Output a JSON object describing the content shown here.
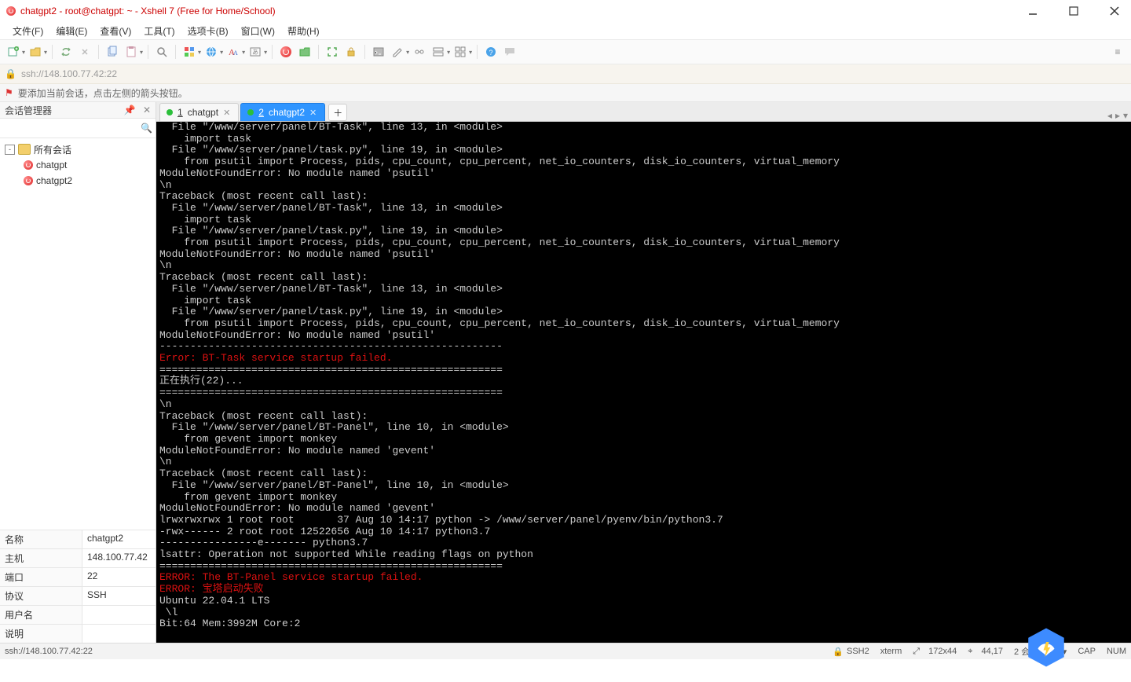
{
  "title": "chatgpt2 - root@chatgpt: ~ - Xshell 7 (Free for Home/School)",
  "menubar": [
    "文件(F)",
    "编辑(E)",
    "查看(V)",
    "工具(T)",
    "选项卡(B)",
    "窗口(W)",
    "帮助(H)"
  ],
  "addressbar": {
    "text": "ssh://148.100.77.42:22"
  },
  "hint": "要添加当前会话，点击左侧的箭头按钮。",
  "sidebar": {
    "title": "会话管理器",
    "search_placeholder": "",
    "root": "所有会话",
    "sessions": [
      "chatgpt",
      "chatgpt2"
    ],
    "props": {
      "名称": "chatgpt2",
      "主机": "148.100.77.42",
      "端口": "22",
      "协议": "SSH",
      "用户名": "",
      "说明": ""
    }
  },
  "tabs": [
    {
      "index": "1",
      "label": "chatgpt",
      "active": false
    },
    {
      "index": "2",
      "label": "chatgpt2",
      "active": true
    }
  ],
  "terminal": {
    "lines": [
      {
        "t": "  File \"/www/server/panel/BT-Task\", line 13, in <module>"
      },
      {
        "t": "    import task"
      },
      {
        "t": "  File \"/www/server/panel/task.py\", line 19, in <module>"
      },
      {
        "t": "    from psutil import Process, pids, cpu_count, cpu_percent, net_io_counters, disk_io_counters, virtual_memory"
      },
      {
        "t": "ModuleNotFoundError: No module named 'psutil'"
      },
      {
        "t": "\\n"
      },
      {
        "t": "Traceback (most recent call last):"
      },
      {
        "t": "  File \"/www/server/panel/BT-Task\", line 13, in <module>"
      },
      {
        "t": "    import task"
      },
      {
        "t": "  File \"/www/server/panel/task.py\", line 19, in <module>"
      },
      {
        "t": "    from psutil import Process, pids, cpu_count, cpu_percent, net_io_counters, disk_io_counters, virtual_memory"
      },
      {
        "t": "ModuleNotFoundError: No module named 'psutil'"
      },
      {
        "t": "\\n"
      },
      {
        "t": "Traceback (most recent call last):"
      },
      {
        "t": "  File \"/www/server/panel/BT-Task\", line 13, in <module>"
      },
      {
        "t": "    import task"
      },
      {
        "t": "  File \"/www/server/panel/task.py\", line 19, in <module>"
      },
      {
        "t": "    from psutil import Process, pids, cpu_count, cpu_percent, net_io_counters, disk_io_counters, virtual_memory"
      },
      {
        "t": "ModuleNotFoundError: No module named 'psutil'"
      },
      {
        "t": "--------------------------------------------------------"
      },
      {
        "t": "Error: BT-Task service startup failed.",
        "c": "r"
      },
      {
        "t": "========================================================"
      },
      {
        "t": "正在执行(22)..."
      },
      {
        "t": "========================================================"
      },
      {
        "t": "\\n"
      },
      {
        "t": "Traceback (most recent call last):"
      },
      {
        "t": "  File \"/www/server/panel/BT-Panel\", line 10, in <module>"
      },
      {
        "t": "    from gevent import monkey"
      },
      {
        "t": "ModuleNotFoundError: No module named 'gevent'"
      },
      {
        "t": "\\n"
      },
      {
        "t": "Traceback (most recent call last):"
      },
      {
        "t": "  File \"/www/server/panel/BT-Panel\", line 10, in <module>"
      },
      {
        "t": "    from gevent import monkey"
      },
      {
        "t": "ModuleNotFoundError: No module named 'gevent'"
      },
      {
        "t": "lrwxrwxrwx 1 root root       37 Aug 10 14:17 python -> /www/server/panel/pyenv/bin/python3.7"
      },
      {
        "t": "-rwx------ 2 root root 12522656 Aug 10 14:17 python3.7"
      },
      {
        "t": "----------------e------- python3.7"
      },
      {
        "t": "lsattr: Operation not supported While reading flags on python"
      },
      {
        "t": "========================================================"
      },
      {
        "t": "ERROR: The BT-Panel service startup failed.",
        "c": "r"
      },
      {
        "t": "ERROR: 宝塔启动失败",
        "c": "r"
      },
      {
        "t": "Ubuntu 22.04.1 LTS"
      },
      {
        "t": " \\l"
      },
      {
        "t": "Bit:64 Mem:3992M Core:2"
      }
    ]
  },
  "statusbar": {
    "left": "ssh://148.100.77.42:22",
    "ssh": "SSH2",
    "term": "xterm",
    "size": "172x44",
    "pos": "44,17",
    "sessions": "2 会话",
    "cap": "CAP",
    "num": "NUM"
  }
}
